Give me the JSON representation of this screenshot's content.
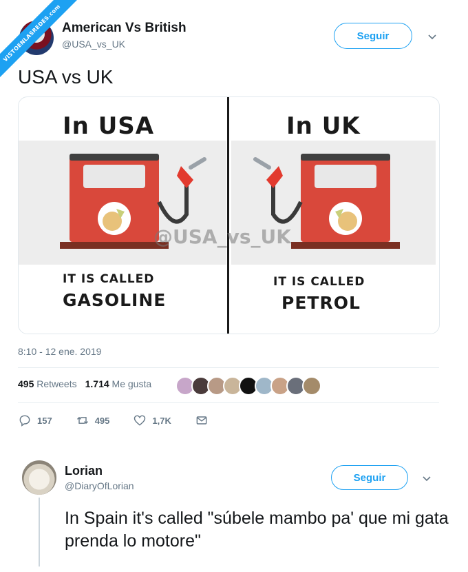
{
  "watermark_ribbon": "VISTOENLASREDES.com",
  "main_tweet": {
    "author_name": "American Vs British",
    "author_handle": "@USA_vs_UK",
    "follow_label": "Seguir",
    "text": "USA vs UK",
    "timestamp": "8:10 - 12 ene. 2019",
    "retweets_count": "495",
    "retweets_label": "Retweets",
    "likes_count": "1.714",
    "likes_label": "Me gusta",
    "reply_count": "157",
    "retweet_action_count": "495",
    "like_action_count": "1,7K"
  },
  "image": {
    "left_title": "In USA",
    "left_called": "IT IS CALLED",
    "left_fuel": "GASOLINE",
    "right_title": "In UK",
    "right_called": "IT IS CALLED",
    "right_fuel": "PETROL",
    "watermark": "@USA_vs_UK"
  },
  "reply_tweet": {
    "author_name": "Lorian",
    "author_handle": "@DiaryOfLorian",
    "follow_label": "Seguir",
    "text": "In Spain it's called \"súbele mambo pa' que mi gata prenda lo motore\""
  },
  "colors": {
    "accent": "#1da1f2",
    "pump_red": "#d9483b",
    "pump_base": "#7a2f22",
    "handle_red": "#e23a2e"
  }
}
